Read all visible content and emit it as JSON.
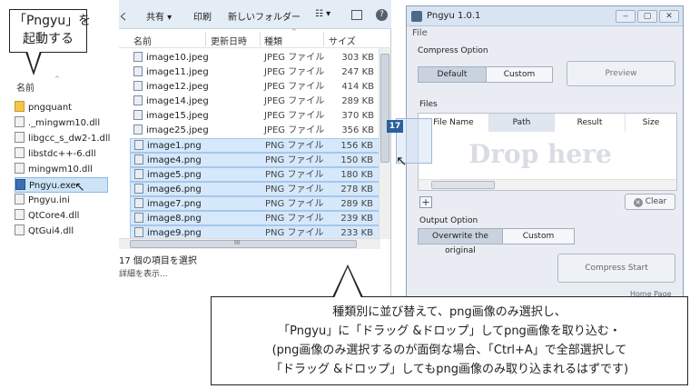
{
  "left_callout": {
    "line1": "「Pngyu」を",
    "line2": "起動する"
  },
  "left_explorer": {
    "column_header": "名前",
    "files": [
      {
        "name": "pngquant",
        "icon": "folder-icon"
      },
      {
        "name": "._mingwm10.dll",
        "icon": "dll-icon"
      },
      {
        "name": "libgcc_s_dw2-1.dll",
        "icon": "dll-icon"
      },
      {
        "name": "libstdc++-6.dll",
        "icon": "dll-icon"
      },
      {
        "name": "mingwm10.dll",
        "icon": "dll-icon"
      },
      {
        "name": "Pngyu.exe",
        "icon": "exe-icon"
      },
      {
        "name": "Pngyu.ini",
        "icon": "ini-icon"
      },
      {
        "name": "QtCore4.dll",
        "icon": "dll-icon"
      },
      {
        "name": "QtGui4.dll",
        "icon": "dll-icon"
      }
    ]
  },
  "mid_explorer": {
    "toolbar": {
      "back": "く",
      "share": "共有 ▾",
      "print": "印刷",
      "new_folder": "新しいフォルダー",
      "view": "☷ ▾",
      "help": "?"
    },
    "columns": {
      "name": "名前",
      "date": "更新日時",
      "type": "種類",
      "size": "サイズ"
    },
    "files": [
      {
        "name": "image10.jpeg",
        "type": "JPEG ファイル",
        "size": "303 KB"
      },
      {
        "name": "image11.jpeg",
        "type": "JPEG ファイル",
        "size": "247 KB"
      },
      {
        "name": "image12.jpeg",
        "type": "JPEG ファイル",
        "size": "414 KB"
      },
      {
        "name": "image14.jpeg",
        "type": "JPEG ファイル",
        "size": "289 KB"
      },
      {
        "name": "image15.jpeg",
        "type": "JPEG ファイル",
        "size": "370 KB"
      },
      {
        "name": "image25.jpeg",
        "type": "JPEG ファイル",
        "size": "356 KB"
      },
      {
        "name": "image1.png",
        "type": "PNG ファイル",
        "size": "156 KB"
      },
      {
        "name": "image4.png",
        "type": "PNG ファイル",
        "size": "150 KB"
      },
      {
        "name": "image5.png",
        "type": "PNG ファイル",
        "size": "180 KB"
      },
      {
        "name": "image6.png",
        "type": "PNG ファイル",
        "size": "278 KB"
      },
      {
        "name": "image7.png",
        "type": "PNG ファイル",
        "size": "289 KB"
      },
      {
        "name": "image8.png",
        "type": "PNG ファイル",
        "size": "239 KB"
      },
      {
        "name": "image9.png",
        "type": "PNG ファイル",
        "size": "233 KB"
      }
    ],
    "status_count": "17 個の項目を選択",
    "status_detail": "詳細を表示...",
    "hscroll_mark": "III"
  },
  "drag_badge": "17",
  "pngyu": {
    "title": "Pngyu 1.0.1",
    "menu_file": "File",
    "compress_option_label": "Compress Option",
    "default_label": "Default",
    "custom_label": "Custom",
    "preview_label": "Preview",
    "files_label": "Files",
    "file_columns": {
      "file_name": "File Name",
      "path": "Path",
      "result": "Result",
      "size": "Size"
    },
    "drop_here": "Drop here",
    "add_label": "+",
    "clear_label": "Clear",
    "output_option_label": "Output Option",
    "overwrite_label": "Overwrite the original",
    "output_custom_label": "Custom",
    "compress_start_label": "Compress Start",
    "home_page_label": "Home Page",
    "minimize": "‒",
    "maximize": "▢",
    "close": "✕"
  },
  "bottom_callout": {
    "line1": "種類別に並び替えて、png画像のみ選択し、",
    "line2": "「Pngyu」に「ドラッグ &ドロップ」してpng画像を取り込む・",
    "line3": "(png画像のみ選択するのが面倒な場合、「Ctrl+A」で全部選択して",
    "line4": "「ドラッグ &ドロップ」してもpng画像のみ取り込まれるはずです)"
  }
}
